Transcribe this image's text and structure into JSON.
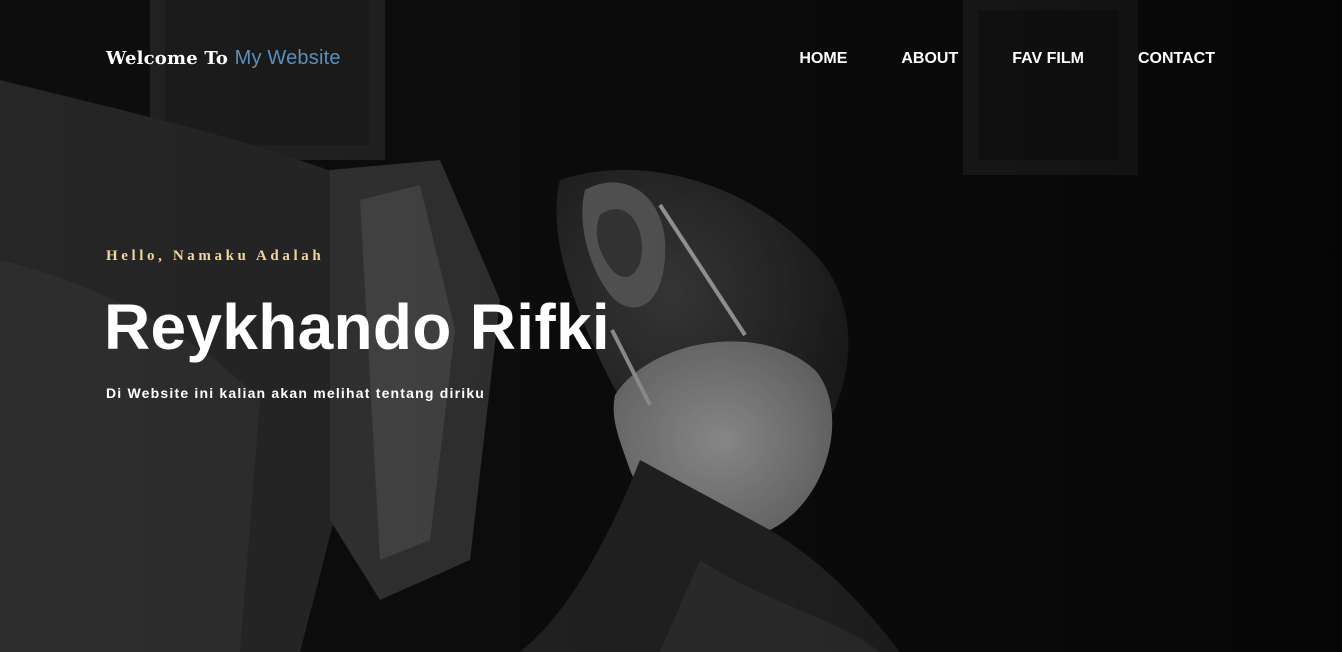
{
  "header": {
    "brand_prefix": "Welcome To",
    "brand_accent": "My Website",
    "nav": [
      {
        "label": "HOME"
      },
      {
        "label": "ABOUT"
      },
      {
        "label": "FAV FILM"
      },
      {
        "label": "CONTACT"
      }
    ]
  },
  "hero": {
    "greeting": "Hello, Namaku Adalah",
    "name": "Reykhando Rifki",
    "tagline": "Di Website ini kalian akan melihat tentang diriku"
  },
  "colors": {
    "brand_accent": "#5b8fb9",
    "greeting": "#f3d49a",
    "text": "#ffffff",
    "background": "#0c0c0c"
  }
}
